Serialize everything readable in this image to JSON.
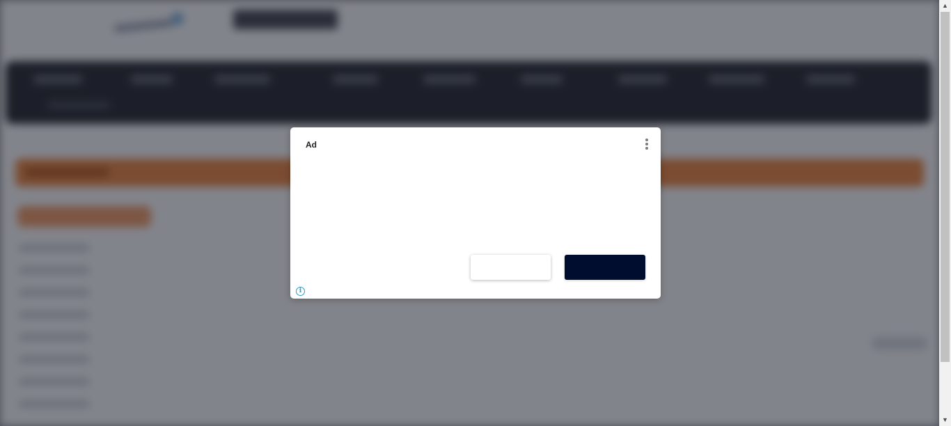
{
  "dialog": {
    "ad_label": "Ad",
    "options_icon": "more-vertical-icon",
    "info_icon": "info-icon",
    "secondary_button_label": "",
    "primary_button_label": ""
  },
  "colors": {
    "overlay": "#101420",
    "primary_button": "#000d2e",
    "info_accent": "#1aa4d9",
    "banner_accent": "#f08b45"
  }
}
